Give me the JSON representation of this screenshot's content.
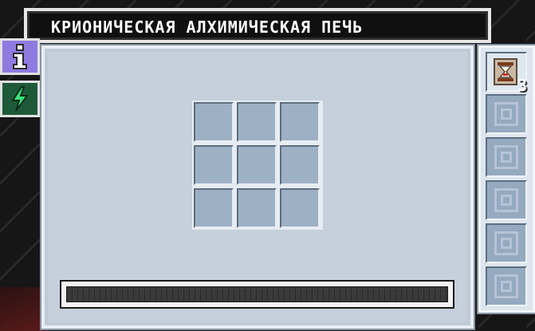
{
  "window": {
    "title": "КРИОНИЧЕСКАЯ АЛХИМИЧЕСКАЯ ПЕЧЬ"
  },
  "tabs": [
    {
      "name": "info",
      "icon": "info-icon"
    },
    {
      "name": "energy",
      "icon": "lightning-icon"
    }
  ],
  "crafting_grid": {
    "rows": 3,
    "cols": 3
  },
  "progress": {
    "value": 0
  },
  "side_slots": [
    {
      "kind": "upgrade",
      "icon": "upgrade-hourglass-icon",
      "count": "3"
    },
    {
      "kind": "empty"
    },
    {
      "kind": "empty"
    },
    {
      "kind": "empty"
    },
    {
      "kind": "empty"
    },
    {
      "kind": "empty"
    }
  ],
  "colors": {
    "panel": "#c6d0dc",
    "slot": "#9eb0c4",
    "info_tab": "#8e7be0",
    "energy_tab": "#1e5a3a",
    "lightning": "#39e27a"
  }
}
